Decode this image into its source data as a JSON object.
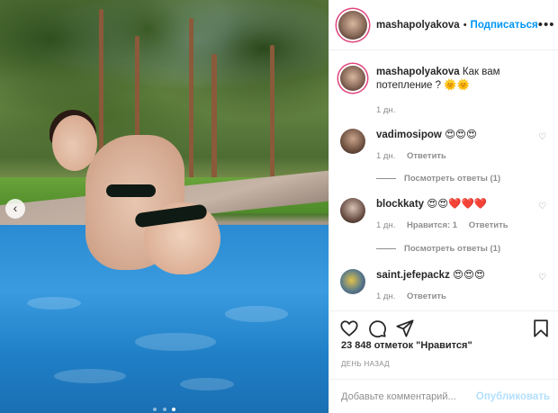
{
  "post": {
    "username": "mashapolyakova",
    "separator": "•",
    "follow_label": "Подписаться",
    "more_icon": "more-horizontal-icon",
    "photo_nav_arrow": "‹",
    "caption_text": "Как вам потепление ? 🌞🌞",
    "caption_time": "1 дн."
  },
  "comments": [
    {
      "username": "vadimosipow",
      "text": "😍😍😍",
      "time": "1 дн.",
      "reply_label": "Ответить",
      "likes_label": "",
      "view_replies": "Посмотреть ответы (1)"
    },
    {
      "username": "blockkaty",
      "text": "😍😍❤️❤️❤️",
      "time": "1 дн.",
      "likes_label": "Нравится: 1",
      "reply_label": "Ответить",
      "view_replies": "Посмотреть ответы (1)"
    },
    {
      "username": "saint.jefepackz",
      "text": "😍😍😍",
      "time": "1 дн.",
      "reply_label": "Ответить",
      "likes_label": "",
      "view_replies": ""
    }
  ],
  "actions": {
    "like_icon": "heart-icon",
    "comment_icon": "comment-icon",
    "share_icon": "share-icon",
    "save_icon": "bookmark-icon"
  },
  "likes_text": "23 848 отметок \"Нравится\"",
  "date_text": "ДЕНЬ НАЗАД",
  "add_comment": {
    "placeholder": "Добавьте комментарий...",
    "publish_label": "Опубликовать"
  },
  "carousel": {
    "count": 3,
    "active_index": 2
  },
  "colors": {
    "follow": "#0095f6",
    "publish_disabled": "#b2dffc",
    "story_ring": "#e0457b"
  }
}
